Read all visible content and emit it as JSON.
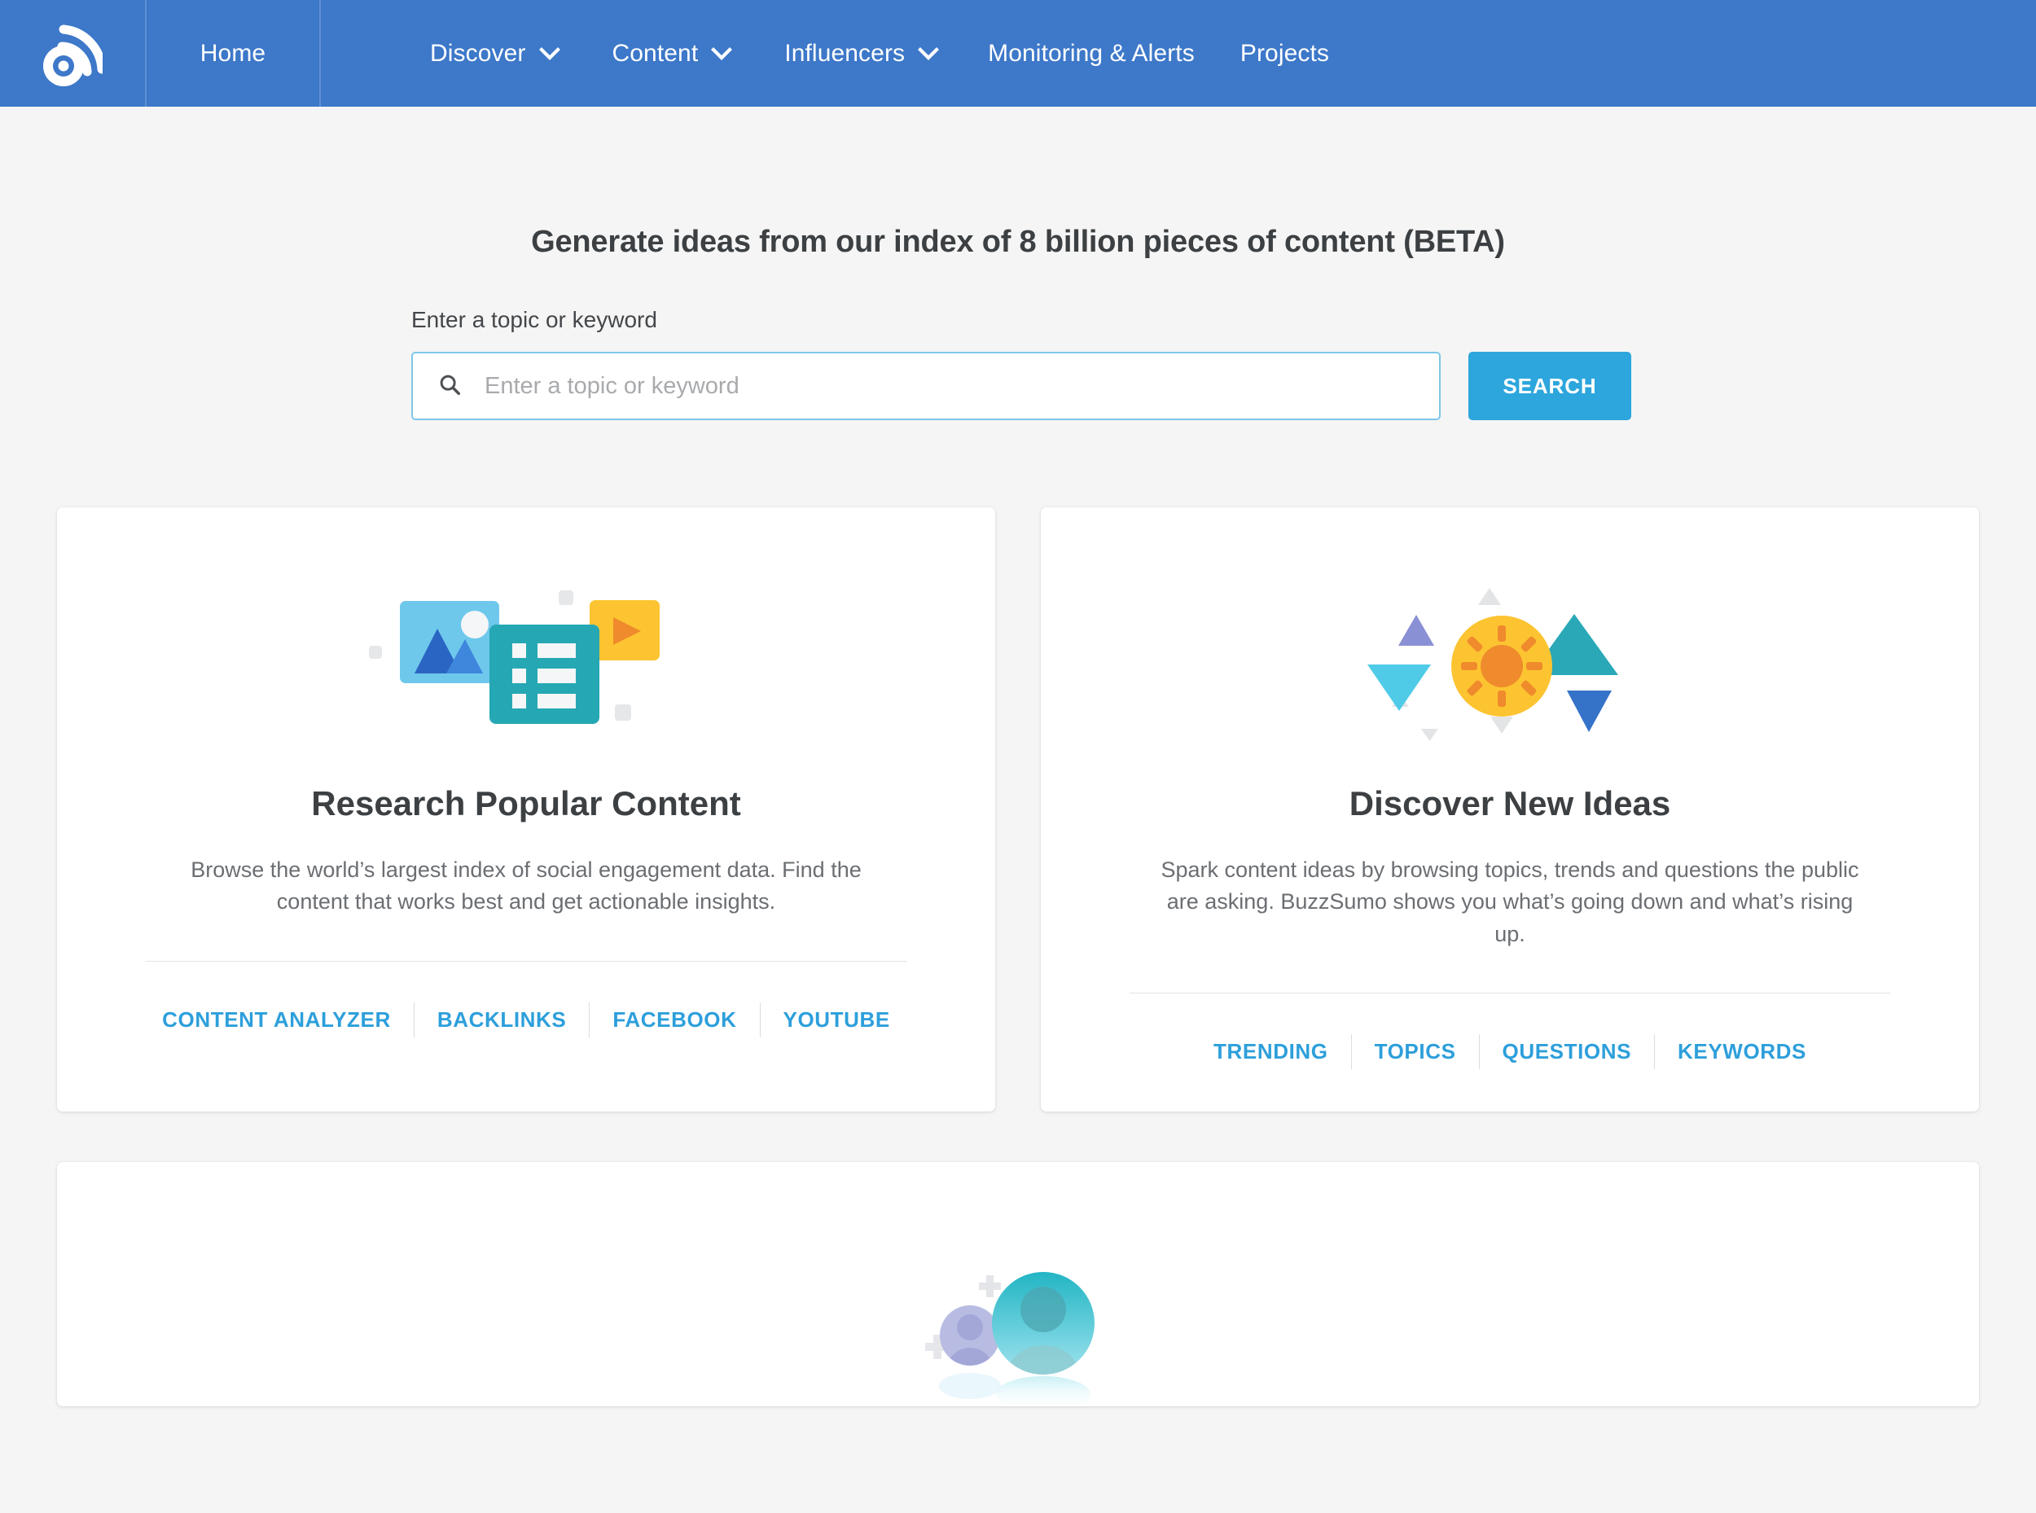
{
  "nav": {
    "logo_icon": "buzzsumo-rss-logo-icon",
    "home_label": "Home",
    "items": [
      {
        "label": "Discover",
        "has_dropdown": true,
        "icon": "chevron-down-icon"
      },
      {
        "label": "Content",
        "has_dropdown": true,
        "icon": "chevron-down-icon"
      },
      {
        "label": "Influencers",
        "has_dropdown": true,
        "icon": "chevron-down-icon"
      },
      {
        "label": "Monitoring & Alerts",
        "has_dropdown": false,
        "icon": ""
      },
      {
        "label": "Projects",
        "has_dropdown": false,
        "icon": ""
      }
    ],
    "background_color": "#3d78c9"
  },
  "hero": {
    "title": "Generate ideas from our index of 8 billion pieces of content (BETA)"
  },
  "search": {
    "label": "Enter a topic or keyword",
    "placeholder": "Enter a topic or keyword",
    "value": "",
    "icon": "search-icon",
    "button_label": "SEARCH",
    "button_color": "#2ca6dd",
    "border_color": "#7ec7e9"
  },
  "cards": [
    {
      "art": "media-content-illustration",
      "title": "Research Popular Content",
      "description": "Browse the world’s largest index of social engagement data. Find the content that works best and get actionable insights.",
      "links": [
        "CONTENT ANALYZER",
        "BACKLINKS",
        "FACEBOOK",
        "YOUTUBE"
      ]
    },
    {
      "art": "sun-triangles-illustration",
      "title": "Discover New Ideas",
      "description": "Spark content ideas by browsing topics, trends and questions the public are asking. BuzzSumo shows you what’s going down and what’s rising up.",
      "links": [
        "TRENDING",
        "TOPICS",
        "QUESTIONS",
        "KEYWORDS"
      ]
    }
  ],
  "bottom_card": {
    "art": "influencer-avatars-illustration"
  },
  "colors": {
    "nav_blue": "#3d78c9",
    "accent_blue": "#2ca6dd",
    "link_blue": "#2d9fdb",
    "page_bg": "#f5f5f5",
    "card_bg": "#ffffff",
    "heading": "#3c4043",
    "body_text": "#6b6e72"
  }
}
